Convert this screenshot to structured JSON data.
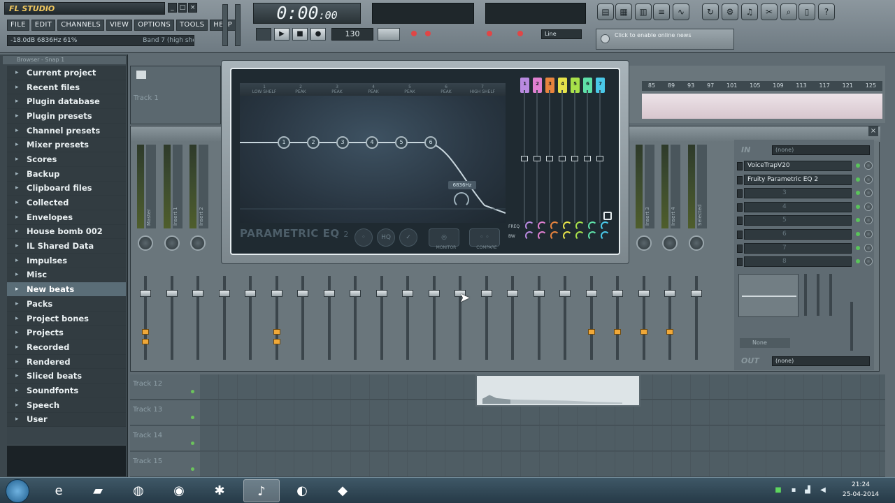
{
  "app": {
    "logo_text": "FL STUDIO",
    "window_buttons": [
      "_",
      "□",
      "×"
    ]
  },
  "menu": [
    "FILE",
    "EDIT",
    "CHANNELS",
    "VIEW",
    "OPTIONS",
    "TOOLS",
    "HELP"
  ],
  "hint": {
    "left": "-18.0dB  6836Hz  61%",
    "right": "Band 7 (high shelf)"
  },
  "transport": {
    "time": "0:00",
    "time_small": ":00",
    "tempo": "130",
    "line_mode": "Line",
    "news": "Click to enable online news"
  },
  "browser": {
    "title": "Browser - Snap 1",
    "items": [
      "Current project",
      "Recent files",
      "Plugin database",
      "Plugin presets",
      "Channel presets",
      "Mixer presets",
      "Scores",
      "Backup",
      "Clipboard files",
      "Collected",
      "Envelopes",
      "House bomb 002",
      "IL Shared Data",
      "Impulses",
      "Misc",
      "New beats",
      "Packs",
      "Project bones",
      "Projects",
      "Recorded",
      "Rendered",
      "Sliced beats",
      "Soundfonts",
      "Speech",
      "User"
    ],
    "selected_index": 15
  },
  "playlist": {
    "tracks": [
      "Track 12",
      "Track 13",
      "Track 14",
      "Track 15"
    ],
    "ruler": [
      "85",
      "89",
      "93",
      "97",
      "101",
      "105",
      "109",
      "113",
      "117",
      "121",
      "125"
    ],
    "channel_track": "Track 1"
  },
  "mixer": {
    "strip_labels": [
      "Master",
      "Insert 1",
      "Insert 2"
    ],
    "right_strip_labels": [
      "Insert 3",
      "Insert 4",
      "Selected"
    ],
    "in_label": "IN",
    "input_value": "(none)",
    "out_label": "OUT",
    "output_value": "(none)",
    "fx_slots": [
      "VoiceTrapV20",
      "Fruity Parametric EQ 2",
      "",
      "",
      "",
      "",
      "",
      ""
    ],
    "slot_numbers": [
      "1",
      "2",
      "3",
      "4",
      "5",
      "6",
      "7",
      "8"
    ],
    "route_label": "None"
  },
  "eq": {
    "title": "PARAMETRIC EQ",
    "title_sub": "2",
    "bands": [
      "LOW SHELF",
      "PEAK",
      "PEAK",
      "PEAK",
      "PEAK",
      "PEAK",
      "HIGH SHELF"
    ],
    "band_numbers": [
      "1",
      "2",
      "3",
      "4",
      "5",
      "6",
      "7"
    ],
    "tooltip": "6836Hz",
    "monitor_label": "MONITOR",
    "compare_label": "COMPARE",
    "freq_label": "FREQ",
    "bw_label": "BW",
    "band_colors": [
      "#b98ae0",
      "#e07fd0",
      "#e8843e",
      "#e6e24a",
      "#a8e04a",
      "#5ee0a8",
      "#4ac8e8"
    ]
  },
  "taskbar": {
    "time": "21:24",
    "date": "25-04-2014"
  }
}
